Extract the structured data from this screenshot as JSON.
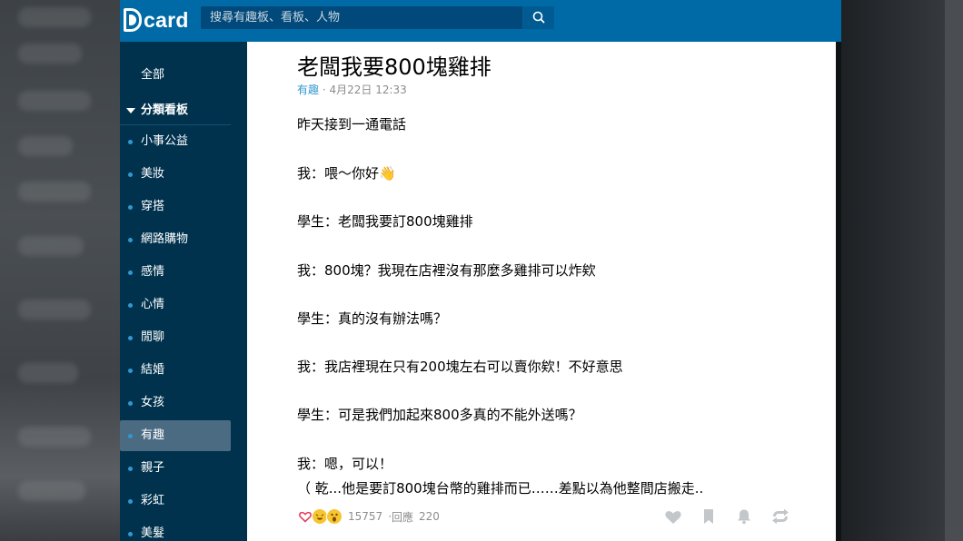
{
  "header": {
    "logo": "card",
    "search_placeholder": "搜尋有趣板、看板、人物"
  },
  "sidebar": {
    "all_label": "全部",
    "section_label": "分類看板",
    "items": [
      {
        "label": "小事公益"
      },
      {
        "label": "美妝"
      },
      {
        "label": "穿搭"
      },
      {
        "label": "網路購物"
      },
      {
        "label": "感情"
      },
      {
        "label": "心情"
      },
      {
        "label": "閒聊"
      },
      {
        "label": "結婚"
      },
      {
        "label": "女孩"
      },
      {
        "label": "有趣"
      },
      {
        "label": "親子"
      },
      {
        "label": "彩虹"
      },
      {
        "label": "美髮"
      }
    ],
    "active_label": "有趣"
  },
  "article": {
    "title": "老闆我要800塊雞排",
    "forum": "有趣",
    "separator": " · ",
    "time": "4月22日 12:33",
    "lines": [
      "昨天接到一通電話",
      "我：喂～你好👋",
      "學生：老闆我要訂800塊雞排",
      "我：800塊？我現在店裡沒有那麼多雞排可以炸欸",
      "學生：真的沒有辦法嗎？",
      "我：我店裡現在只有200塊左右可以賣你欸！不好意思",
      "學生：可是我們加起來800多真的不能外送嗎？",
      "我：嗯，可以！",
      "（ 乾...他是要訂800塊台幣的雞排而已……差點以為他整間店搬走.."
    ],
    "reactions": [
      "heart-icon",
      "haha-icon",
      "wow-icon"
    ],
    "like_count": "15757",
    "reply_label": "回應",
    "reply_count": "220"
  },
  "colors": {
    "header": "#006aa6",
    "sidebar": "#00324e",
    "accent": "#3397cf"
  }
}
